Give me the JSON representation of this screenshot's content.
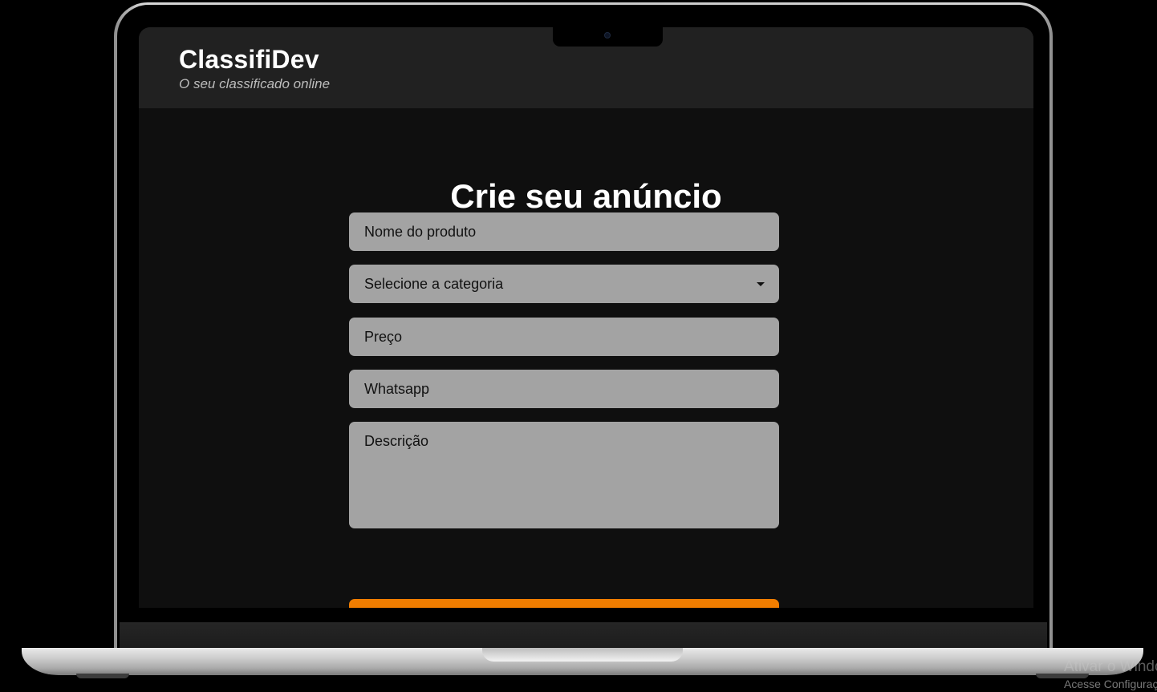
{
  "header": {
    "brand": "ClassifiDev",
    "tagline": "O seu classificado online"
  },
  "main": {
    "title": "Crie seu anúncio",
    "form": {
      "product_name_placeholder": "Nome do produto",
      "category_selected": "Selecione a categoria",
      "price_placeholder": "Preço",
      "whatsapp_placeholder": "Whatsapp",
      "description_placeholder": "Descrição"
    }
  },
  "watermark": {
    "title": "Ativar o Windows",
    "subtitle": "Acesse Configurações para ativar o Windows."
  },
  "colors": {
    "header_bg": "#212121",
    "page_bg": "#0f0f0f",
    "field_bg": "#a3a3a3",
    "accent": "#f07d00"
  },
  "icons": {
    "select_arrow": "chevron-down-icon",
    "camera": "camera-icon"
  }
}
